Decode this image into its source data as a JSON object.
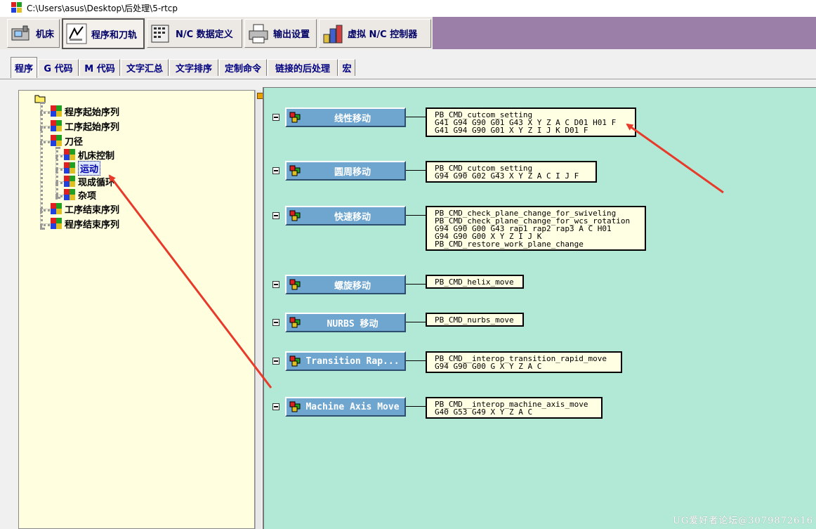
{
  "window": {
    "title": "C:\\Users\\asus\\Desktop\\后处理\\5-rtcp"
  },
  "main_tabs": [
    {
      "label": "机床",
      "icon": "machine-icon"
    },
    {
      "label": "程序和刀轨",
      "icon": "program-toolpath-icon"
    },
    {
      "label": "N/C 数据定义",
      "icon": "nc-data-icon"
    },
    {
      "label": "输出设置",
      "icon": "printer-icon"
    },
    {
      "label": "虚拟 N/C 控制器",
      "icon": "virtual-controller-icon"
    }
  ],
  "sub_tabs": [
    "程序",
    "G 代码",
    "M 代码",
    "文字汇总",
    "文字排序",
    "定制命令",
    "链接的后处理",
    "宏"
  ],
  "tree": {
    "items": [
      {
        "label": "程序起始序列"
      },
      {
        "label": "工序起始序列"
      },
      {
        "label": "刀径"
      },
      {
        "label": "机床控制"
      },
      {
        "label": "运动"
      },
      {
        "label": "现成循环"
      },
      {
        "label": "杂项"
      },
      {
        "label": "工序结束序列"
      },
      {
        "label": "程序结束序列"
      }
    ]
  },
  "events": [
    {
      "label": "线性移动",
      "lines": "PB_CMD_cutcom_setting\nG41 G94 G90 G01 G43 X Y Z A C D01 H01 F\nG41 G94 G90 G01 X Y Z I J K D01 F"
    },
    {
      "label": "圆周移动",
      "lines": "PB_CMD_cutcom_setting\nG94 G90 G02 G43 X Y Z A C I J F"
    },
    {
      "label": "快速移动",
      "lines": "PB_CMD_check_plane_change_for_swiveling\nPB_CMD_check_plane_change_for_wcs_rotation\nG94 G90 G00 G43 rap1 rap2 rap3 A C H01\nG94 G90 G00 X Y Z I J K\nPB_CMD_restore_work_plane_change"
    },
    {
      "label": "螺旋移动",
      "lines": "PB_CMD_helix_move"
    },
    {
      "label": "NURBS 移动",
      "lines": "PB_CMD_nurbs_move"
    },
    {
      "label": "Transition Rap...",
      "lines": "PB_CMD__interop_transition_rapid_move\nG94 G90 G00 G X Y Z A C"
    },
    {
      "label": "Machine Axis Move",
      "lines": "PB_CMD__interop_machine_axis_move\nG40 G53 G49 X Y Z A C"
    }
  ],
  "watermark": "UG爱好者论坛@3079872616",
  "colors": {
    "canvas": "#b1e8d6",
    "event_button": "#6fa6d0",
    "tree_bg": "#ffffe0",
    "tab_strip": "#9b7fa8",
    "arrow": "#e83a2a"
  }
}
